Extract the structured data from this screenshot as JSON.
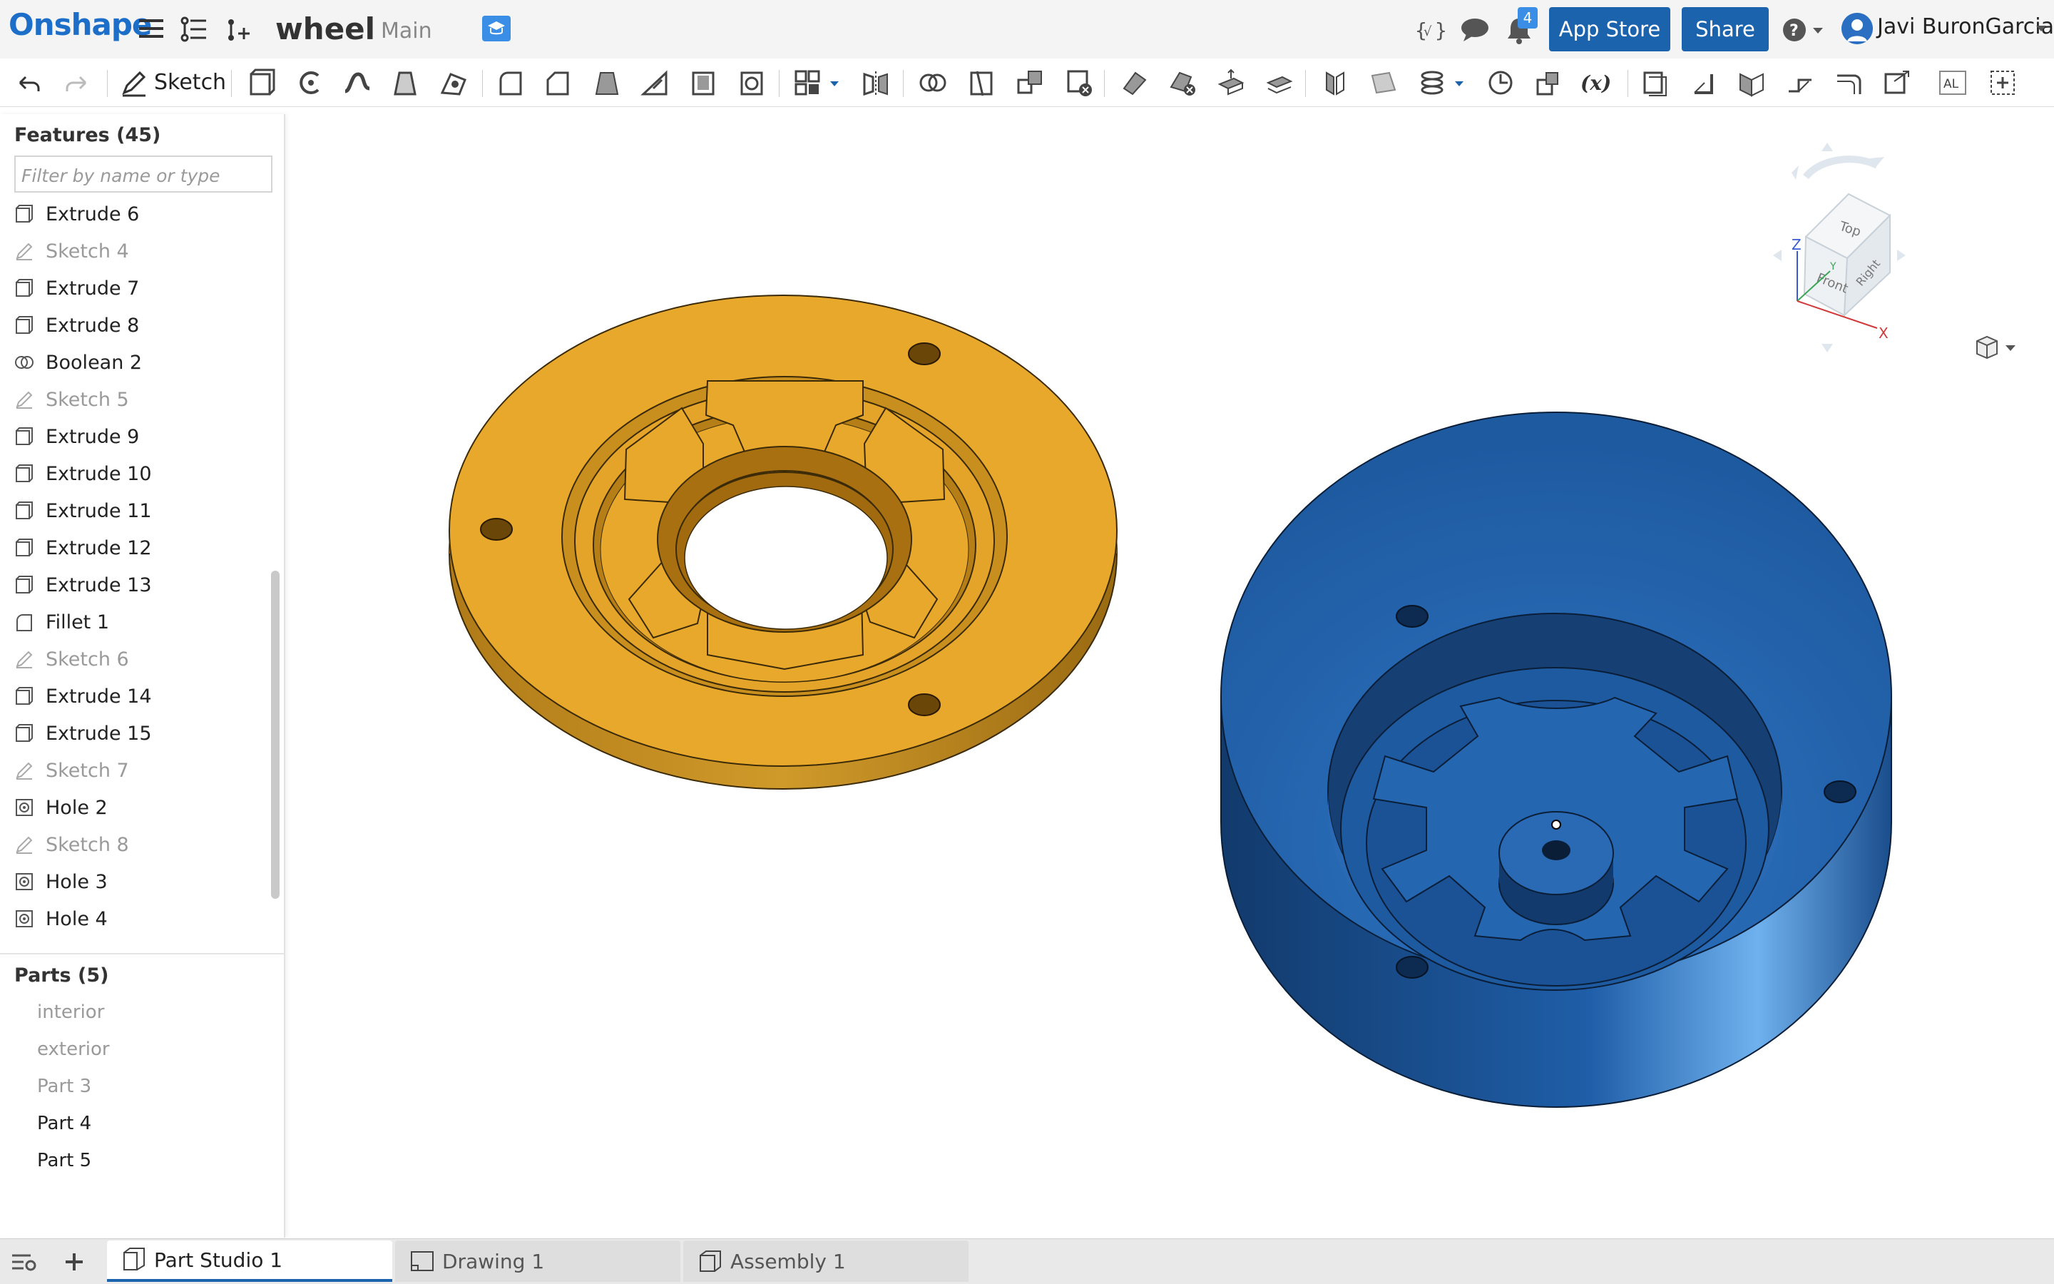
{
  "app": {
    "logo": "Onshape"
  },
  "document": {
    "title": "wheel",
    "workspace": "Main"
  },
  "header": {
    "notification_count": "4",
    "app_store_label": "App Store",
    "share_label": "Share",
    "user_name": "Javi BuronGarcia"
  },
  "toolbar": {
    "sketch_label": "Sketch"
  },
  "features": {
    "heading": "Features (45)",
    "filter_placeholder": "Filter by name or type",
    "items": [
      {
        "label": "Extrude 6",
        "type": "extrude"
      },
      {
        "label": "Sketch 4",
        "type": "sketch"
      },
      {
        "label": "Extrude 7",
        "type": "extrude"
      },
      {
        "label": "Extrude 8",
        "type": "extrude"
      },
      {
        "label": "Boolean 2",
        "type": "boolean"
      },
      {
        "label": "Sketch 5",
        "type": "sketch"
      },
      {
        "label": "Extrude 9",
        "type": "extrude"
      },
      {
        "label": "Extrude 10",
        "type": "extrude"
      },
      {
        "label": "Extrude 11",
        "type": "extrude"
      },
      {
        "label": "Extrude 12",
        "type": "extrude"
      },
      {
        "label": "Extrude 13",
        "type": "extrude"
      },
      {
        "label": "Fillet 1",
        "type": "fillet"
      },
      {
        "label": "Sketch 6",
        "type": "sketch"
      },
      {
        "label": "Extrude 14",
        "type": "extrude"
      },
      {
        "label": "Extrude 15",
        "type": "extrude"
      },
      {
        "label": "Sketch 7",
        "type": "sketch"
      },
      {
        "label": "Hole 2",
        "type": "hole"
      },
      {
        "label": "Sketch 8",
        "type": "sketch"
      },
      {
        "label": "Hole 3",
        "type": "hole"
      },
      {
        "label": "Hole 4",
        "type": "hole"
      }
    ]
  },
  "parts": {
    "heading": "Parts (5)",
    "items": [
      {
        "label": "interior",
        "hidden": true
      },
      {
        "label": "exterior",
        "hidden": true
      },
      {
        "label": "Part 3",
        "hidden": true
      },
      {
        "label": "Part 4",
        "hidden": false
      },
      {
        "label": "Part 5",
        "hidden": false
      }
    ]
  },
  "tabs": [
    {
      "label": "Part Studio 1",
      "active": true
    },
    {
      "label": "Drawing 1",
      "active": false
    },
    {
      "label": "Assembly 1",
      "active": false
    }
  ],
  "viewcube": {
    "faces": [
      "Top",
      "Front",
      "Right"
    ],
    "axes": [
      "Z",
      "Y",
      "X"
    ]
  },
  "colors": {
    "brand": "#1d6ec8",
    "button": "#1c63ad",
    "part_orange": "#e8a82c",
    "part_blue": "#1f5ea8"
  }
}
